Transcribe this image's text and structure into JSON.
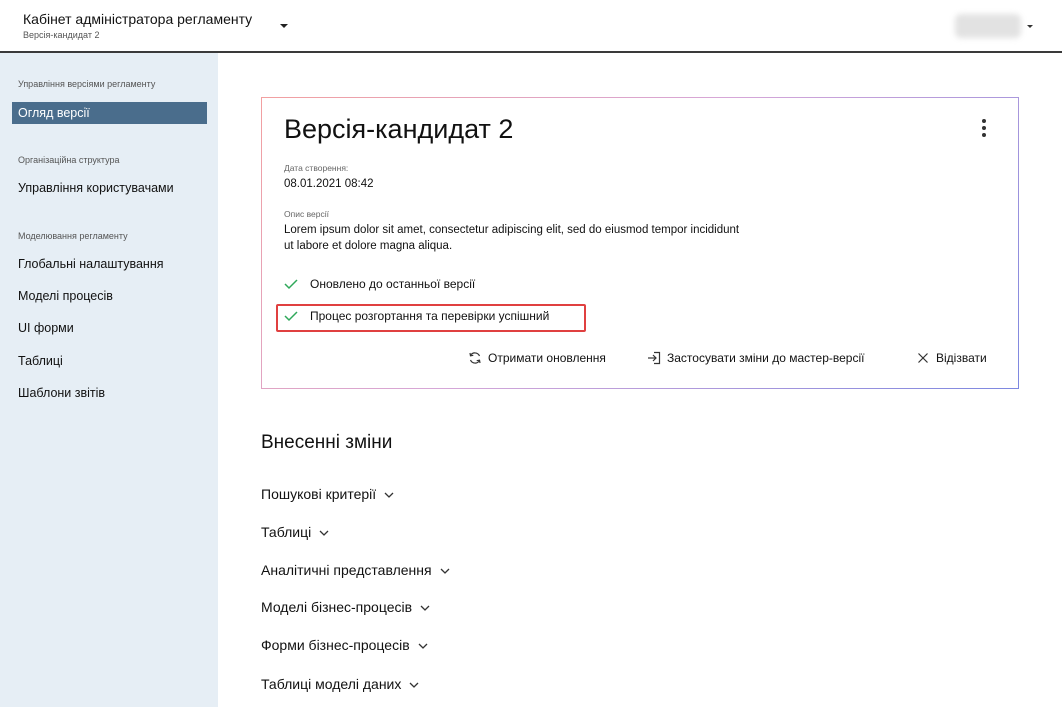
{
  "header": {
    "app_title": "Кабінет адміністратора регламенту",
    "app_subtitle": "Версія-кандидат 2"
  },
  "sidebar": {
    "sections": [
      {
        "title": "Управління версіями регламенту",
        "items": [
          "Огляд версії"
        ]
      },
      {
        "title": "Організаційна структура",
        "items": [
          "Управління користувачами"
        ]
      },
      {
        "title": "Моделювання регламенту",
        "items": [
          "Глобальні налаштування",
          "Моделі процесів",
          "UI форми",
          "Таблиці",
          "Шаблони звітів"
        ]
      }
    ],
    "active_item": "Огляд версії"
  },
  "card": {
    "title": "Версія-кандидат 2",
    "created_label": "Дата створення:",
    "created_value": "08.01.2021 08:42",
    "desc_label": "Опис версії",
    "desc_value": "Lorem ipsum dolor sit amet, consectetur adipiscing elit, sed do eiusmod tempor incididunt ut labore et dolore magna aliqua.",
    "statuses": [
      "Оновлено до останньої версії",
      "Процес розгортання та перевірки успішний"
    ],
    "actions": [
      "Отримати оновлення",
      "Застосувати зміни до мастер-версії",
      "Відізвати"
    ]
  },
  "changes": {
    "title": "Внесенні зміни",
    "items": [
      "Пошукові критерії",
      "Таблиці",
      "Аналітичні представлення",
      "Моделі бізнес-процесів",
      "Форми бізнес-процесів",
      "Таблиці моделі даних"
    ]
  },
  "colors": {
    "sidebar_bg": "#e6eef5",
    "active_item_bg": "#4a6d8c",
    "check_green": "#2fa85a",
    "highlight_red": "#e04040"
  },
  "icons": [
    "chevron-down-icon",
    "more-vertical-icon",
    "check-icon",
    "refresh-icon",
    "sign-in-icon",
    "close-icon"
  ]
}
